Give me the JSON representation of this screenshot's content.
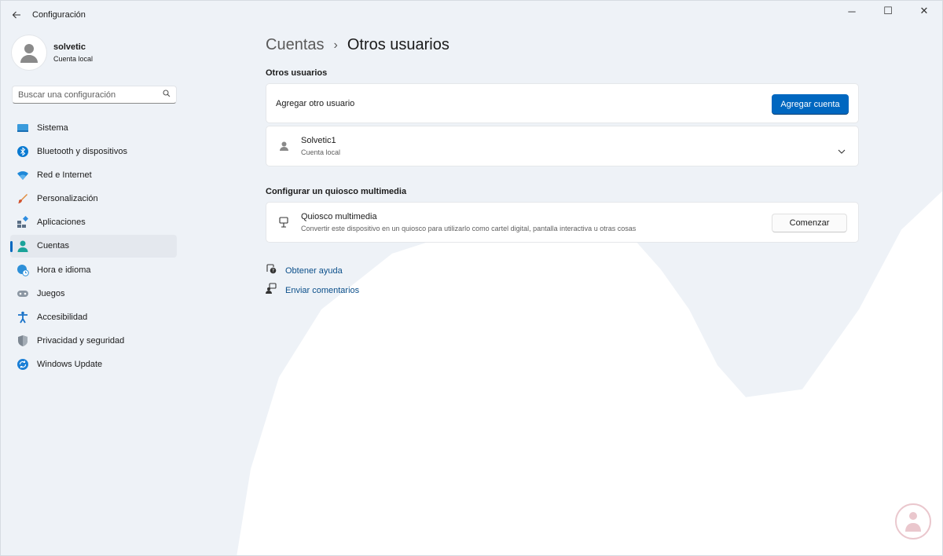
{
  "window": {
    "title": "Configuración",
    "controls": {
      "minimize": "─",
      "maximize": "☐",
      "close": "✕"
    }
  },
  "profile": {
    "name": "solvetic",
    "account_type": "Cuenta local"
  },
  "search": {
    "placeholder": "Buscar una configuración"
  },
  "sidebar": {
    "items": [
      {
        "label": "Sistema",
        "icon": "monitor-icon"
      },
      {
        "label": "Bluetooth y dispositivos",
        "icon": "bluetooth-icon"
      },
      {
        "label": "Red e Internet",
        "icon": "wifi-icon"
      },
      {
        "label": "Personalización",
        "icon": "brush-icon"
      },
      {
        "label": "Aplicaciones",
        "icon": "apps-icon"
      },
      {
        "label": "Cuentas",
        "icon": "account-icon",
        "active": true
      },
      {
        "label": "Hora e idioma",
        "icon": "globe-clock-icon"
      },
      {
        "label": "Juegos",
        "icon": "gamepad-icon"
      },
      {
        "label": "Accesibilidad",
        "icon": "accessibility-icon"
      },
      {
        "label": "Privacidad y seguridad",
        "icon": "shield-icon"
      },
      {
        "label": "Windows Update",
        "icon": "update-icon"
      }
    ]
  },
  "breadcrumb": {
    "parent": "Cuentas",
    "separator": "›",
    "current": "Otros usuarios"
  },
  "other_users": {
    "section_title": "Otros usuarios",
    "add_label": "Agregar otro usuario",
    "add_button": "Agregar cuenta",
    "users": [
      {
        "name": "Solvetic1",
        "type": "Cuenta local"
      }
    ]
  },
  "kiosk": {
    "section_title": "Configurar un quiosco multimedia",
    "title": "Quiosco multimedia",
    "description": "Convertir este dispositivo en un quiosco para utilizarlo como cartel digital, pantalla interactiva u otras cosas",
    "button": "Comenzar"
  },
  "links": {
    "help": "Obtener ayuda",
    "feedback": "Enviar comentarios"
  },
  "colors": {
    "accent": "#0067c0",
    "background": "#eef2f7",
    "card": "#ffffff"
  }
}
